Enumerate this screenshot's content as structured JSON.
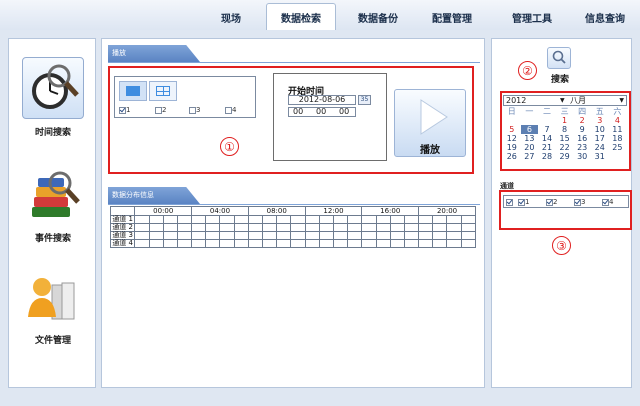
{
  "top_menu": [
    {
      "label": "现场",
      "active": false
    },
    {
      "label": "数据检索",
      "active": true
    },
    {
      "label": "数据备份",
      "active": false
    },
    {
      "label": "配置管理",
      "active": false
    },
    {
      "label": "管理工具",
      "active": false
    },
    {
      "label": "信息查询",
      "active": false
    }
  ],
  "sidebar": {
    "items": [
      {
        "label": "时间搜索",
        "icon": "clock-magnifier-icon",
        "selected": true
      },
      {
        "label": "事件搜索",
        "icon": "books-magnifier-icon",
        "selected": false
      },
      {
        "label": "文件管理",
        "icon": "user-files-icon",
        "selected": false
      }
    ]
  },
  "playback": {
    "section_title": "播放",
    "channel_labels": [
      "1",
      "2",
      "3",
      "4"
    ],
    "channel_checked": [
      true,
      false,
      false,
      false
    ],
    "start_time_label": "开始时间",
    "start_date": "2012-08-06",
    "start_hour": "00",
    "start_minute": "00",
    "start_second": "00",
    "play_label": "播放"
  },
  "distribution": {
    "section_title": "数据分布信息",
    "time_headers": [
      "00:00",
      "04:00",
      "08:00",
      "12:00",
      "16:00",
      "20:00"
    ],
    "channels": [
      "通道 1",
      "通道 2",
      "通道 3",
      "通道 4"
    ]
  },
  "search": {
    "label": "搜索"
  },
  "calendar": {
    "year": "2012",
    "month": "八月",
    "weekdays": [
      "日",
      "一",
      "二",
      "三",
      "四",
      "五",
      "六"
    ],
    "weeks": [
      [
        "",
        "",
        "",
        "1",
        "2",
        "3",
        "4"
      ],
      [
        "5",
        "6",
        "7",
        "8",
        "9",
        "10",
        "11"
      ],
      [
        "12",
        "13",
        "14",
        "15",
        "16",
        "17",
        "18"
      ],
      [
        "19",
        "20",
        "21",
        "22",
        "23",
        "24",
        "25"
      ],
      [
        "26",
        "27",
        "28",
        "29",
        "30",
        "31",
        ""
      ]
    ],
    "selected_day": "6",
    "red_days": [
      "1",
      "2",
      "3",
      "4",
      "5"
    ]
  },
  "channel_panel": {
    "title": "通道",
    "labels": [
      "1",
      "2",
      "3",
      "4"
    ],
    "checked": [
      true,
      true,
      true,
      true
    ]
  },
  "annotations": {
    "one": "①",
    "two": "②",
    "three": "③"
  },
  "colors": {
    "accent_blue": "#5a83c3",
    "annotation_red": "#e02020",
    "background": "#dfe7f2"
  }
}
